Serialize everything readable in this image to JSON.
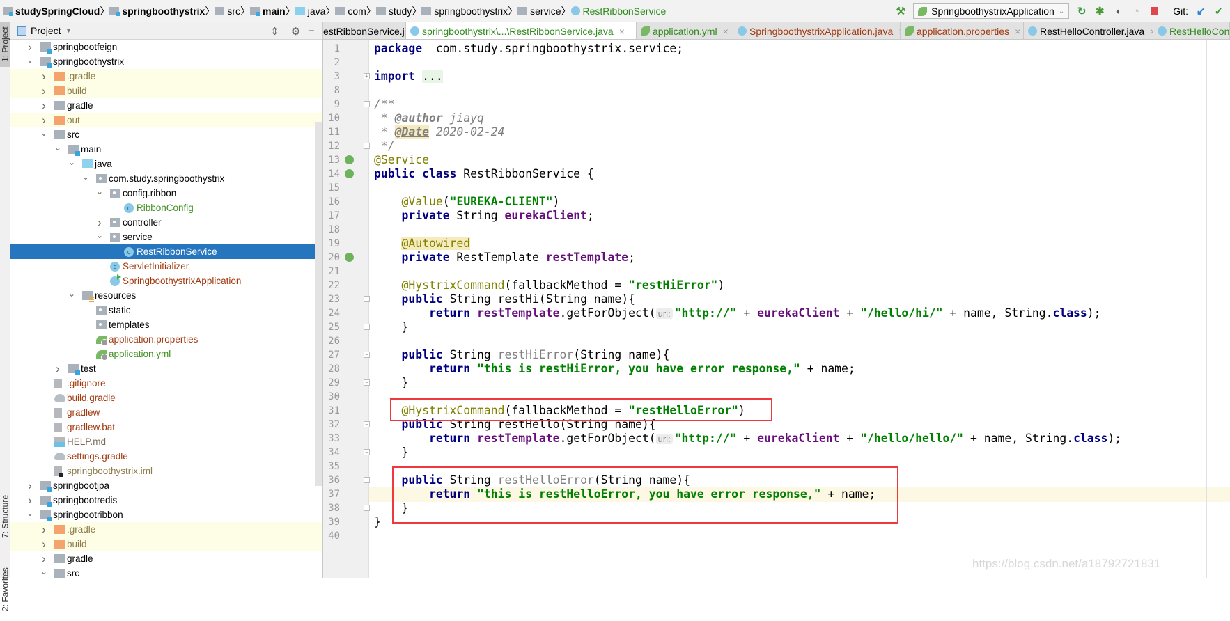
{
  "breadcrumbs": [
    {
      "label": "studySpringCloud",
      "icon": "module-icon",
      "style": "bold"
    },
    {
      "label": "springboothystrix",
      "icon": "module-icon",
      "style": "bold"
    },
    {
      "label": "src",
      "icon": "folder-icon"
    },
    {
      "label": "main",
      "icon": "module-icon",
      "style": "bold"
    },
    {
      "label": "java",
      "icon": "source-folder-icon"
    },
    {
      "label": "com",
      "icon": "package-icon"
    },
    {
      "label": "study",
      "icon": "package-icon"
    },
    {
      "label": "springboothystrix",
      "icon": "package-icon"
    },
    {
      "label": "service",
      "icon": "package-icon"
    },
    {
      "label": "RestRibbonService",
      "icon": "class-icon",
      "style": "green"
    }
  ],
  "toolbar": {
    "run_config": "SpringboothystrixApplication",
    "git_label": "Git:"
  },
  "tool_stripe": {
    "project": "1: Project",
    "structure": "7: Structure",
    "favorites": "2: Favorites"
  },
  "sidebar": {
    "title": "Project",
    "tree": [
      {
        "label": "springbootfeign",
        "level": 0,
        "exp": "closed",
        "icon": "f-mod",
        "color": "#000"
      },
      {
        "label": "springboothystrix",
        "level": 0,
        "exp": "open",
        "icon": "f-mod",
        "color": "#000"
      },
      {
        "label": ".gradle",
        "level": 1,
        "exp": "closed",
        "icon": "f-orange",
        "color": "#8c7d4a",
        "hl": true
      },
      {
        "label": "build",
        "level": 1,
        "exp": "closed",
        "icon": "f-orange",
        "color": "#8c7d4a",
        "hl": true
      },
      {
        "label": "gradle",
        "level": 1,
        "exp": "closed",
        "icon": "f-gray",
        "color": "#000"
      },
      {
        "label": "out",
        "level": 1,
        "exp": "closed",
        "icon": "f-orange",
        "color": "#8c7d4a",
        "hl": true
      },
      {
        "label": "src",
        "level": 1,
        "exp": "open",
        "icon": "f-gray",
        "color": "#000"
      },
      {
        "label": "main",
        "level": 2,
        "exp": "open",
        "icon": "f-src",
        "color": "#000"
      },
      {
        "label": "java",
        "level": 3,
        "exp": "open",
        "icon": "f-blue",
        "color": "#000"
      },
      {
        "label": "com.study.springboothystrix",
        "level": 4,
        "exp": "open",
        "icon": "f-pkg",
        "color": "#000"
      },
      {
        "label": "config.ribbon",
        "level": 5,
        "exp": "open",
        "icon": "f-pkg",
        "color": "#000"
      },
      {
        "label": "RibbonConfig",
        "level": 6,
        "icon": "c-cls",
        "color": "#3f8f20"
      },
      {
        "label": "controller",
        "level": 5,
        "exp": "closed",
        "icon": "f-pkg",
        "color": "#000"
      },
      {
        "label": "service",
        "level": 5,
        "exp": "open",
        "icon": "f-pkg",
        "color": "#000"
      },
      {
        "label": "RestRibbonService",
        "level": 6,
        "icon": "c-cls",
        "color": "#fff",
        "sel": true
      },
      {
        "label": "ServletInitializer",
        "level": 5,
        "icon": "c-cls",
        "color": "#a3390f"
      },
      {
        "label": "SpringboothystrixApplication",
        "level": 5,
        "icon": "c-spring",
        "color": "#a3390f"
      },
      {
        "label": "resources",
        "level": 3,
        "exp": "open",
        "icon": "f-res",
        "color": "#000"
      },
      {
        "label": "static",
        "level": 4,
        "icon": "f-pkg",
        "color": "#000"
      },
      {
        "label": "templates",
        "level": 4,
        "icon": "f-pkg",
        "color": "#000"
      },
      {
        "label": "application.properties",
        "level": 4,
        "icon": "s-leaf",
        "color": "#a3390f"
      },
      {
        "label": "application.yml",
        "level": 4,
        "icon": "s-leaf",
        "color": "#3f8f20"
      },
      {
        "label": "test",
        "level": 2,
        "exp": "closed",
        "icon": "f-src",
        "color": "#000"
      },
      {
        "label": ".gitignore",
        "level": 1,
        "icon": "file-txt",
        "color": "#a3390f"
      },
      {
        "label": "build.gradle",
        "level": 1,
        "icon": "gradle",
        "color": "#a3390f"
      },
      {
        "label": "gradlew",
        "level": 1,
        "icon": "file-txt",
        "color": "#a3390f"
      },
      {
        "label": "gradlew.bat",
        "level": 1,
        "icon": "file-txt",
        "color": "#a3390f"
      },
      {
        "label": "HELP.md",
        "level": 1,
        "icon": "md",
        "color": "#7a6a5a"
      },
      {
        "label": "settings.gradle",
        "level": 1,
        "icon": "gradle",
        "color": "#a3390f"
      },
      {
        "label": "springboothystrix.iml",
        "level": 1,
        "icon": "iml",
        "color": "#8c7d4a"
      },
      {
        "label": "springbootjpa",
        "level": 0,
        "exp": "closed",
        "icon": "f-mod",
        "color": "#000"
      },
      {
        "label": "springbootredis",
        "level": 0,
        "exp": "closed",
        "icon": "f-mod",
        "color": "#000"
      },
      {
        "label": "springbootribbon",
        "level": 0,
        "exp": "open",
        "icon": "f-mod",
        "color": "#000"
      },
      {
        "label": ".gradle",
        "level": 1,
        "exp": "closed",
        "icon": "f-orange",
        "color": "#8c7d4a",
        "hl": true
      },
      {
        "label": "build",
        "level": 1,
        "exp": "closed",
        "icon": "f-orange",
        "color": "#8c7d4a",
        "hl": true
      },
      {
        "label": "gradle",
        "level": 1,
        "exp": "closed",
        "icon": "f-gray",
        "color": "#000"
      },
      {
        "label": "src",
        "level": 1,
        "exp": "open",
        "icon": "f-gray",
        "color": "#000"
      }
    ]
  },
  "tabs": [
    {
      "label": "estRibbonService.java",
      "color": "#000",
      "icon": "none"
    },
    {
      "label": "springboothystrix\\...\\RestRibbonService.java",
      "color": "#2f8a1c",
      "icon": "class",
      "active": true
    },
    {
      "label": "application.yml",
      "color": "#2f8a1c",
      "icon": "leaf"
    },
    {
      "label": "SpringboothystrixApplication.java",
      "color": "#a3390f",
      "icon": "class"
    },
    {
      "label": "application.properties",
      "color": "#a3390f",
      "icon": "leaf"
    },
    {
      "label": "RestHelloController.java",
      "color": "#000",
      "icon": "class"
    },
    {
      "label": "RestHelloContro",
      "color": "#2f8a1c",
      "icon": "class"
    }
  ],
  "editor": {
    "current_line": 37,
    "lines": [
      {
        "n": 1,
        "t": [
          [
            "kw",
            "package"
          ],
          [
            "",
            "  com.study.springboothystrix.service;"
          ]
        ]
      },
      {
        "n": 2,
        "t": []
      },
      {
        "n": 3,
        "fold": "+",
        "t": [
          [
            "kw",
            "import"
          ],
          [
            "",
            " "
          ],
          [
            "foldt",
            "..."
          ]
        ]
      },
      {
        "n": 8,
        "t": []
      },
      {
        "n": 9,
        "fold": "-",
        "t": [
          [
            "cmt",
            "/**"
          ]
        ]
      },
      {
        "n": 10,
        "t": [
          [
            "cmt",
            " * "
          ],
          [
            "tag",
            "@author"
          ],
          [
            "cmt",
            " jiayq"
          ]
        ]
      },
      {
        "n": 11,
        "t": [
          [
            "cmt",
            " * "
          ],
          [
            "tagh",
            "@Date"
          ],
          [
            "cmt",
            " 2020-02-24"
          ]
        ]
      },
      {
        "n": 12,
        "fold": "-",
        "t": [
          [
            "cmt",
            " */"
          ]
        ]
      },
      {
        "n": 13,
        "gicon": "spring-bean-icon",
        "t": [
          [
            "ann",
            "@Service"
          ]
        ]
      },
      {
        "n": 14,
        "gicon": "spring-class-icon",
        "t": [
          [
            "kw",
            "public class"
          ],
          [
            "",
            " RestRibbonService {"
          ]
        ]
      },
      {
        "n": 15,
        "t": []
      },
      {
        "n": 16,
        "t": [
          [
            "",
            "    "
          ],
          [
            "ann",
            "@Value"
          ],
          [
            "",
            "("
          ],
          [
            "str",
            "\"EUREKA-CLIENT\""
          ],
          [
            "",
            ")"
          ]
        ]
      },
      {
        "n": 17,
        "t": [
          [
            "",
            "    "
          ],
          [
            "kw",
            "private"
          ],
          [
            "",
            " String "
          ],
          [
            "fld",
            "eurekaClient"
          ],
          [
            "",
            ";"
          ]
        ]
      },
      {
        "n": 18,
        "t": []
      },
      {
        "n": 19,
        "t": [
          [
            "",
            "    "
          ],
          [
            "annh",
            "@Autowired"
          ]
        ]
      },
      {
        "n": 20,
        "gicon": "autowired-icon",
        "t": [
          [
            "",
            "    "
          ],
          [
            "kw",
            "private"
          ],
          [
            "",
            " RestTemplate "
          ],
          [
            "fld",
            "restTemplate"
          ],
          [
            "",
            ";"
          ]
        ]
      },
      {
        "n": 21,
        "t": []
      },
      {
        "n": 22,
        "t": [
          [
            "",
            "    "
          ],
          [
            "ann",
            "@HystrixCommand"
          ],
          [
            "",
            "(fallbackMethod = "
          ],
          [
            "str",
            "\"restHiError\""
          ],
          [
            "",
            ")"
          ]
        ]
      },
      {
        "n": 23,
        "fold": "-",
        "t": [
          [
            "",
            "    "
          ],
          [
            "kw",
            "public"
          ],
          [
            "",
            " String restHi(String name){"
          ]
        ]
      },
      {
        "n": 24,
        "t": [
          [
            "",
            "        "
          ],
          [
            "kw",
            "return"
          ],
          [
            "",
            " "
          ],
          [
            "fld",
            "restTemplate"
          ],
          [
            "",
            ".getForObject("
          ],
          [
            "hint",
            "url:"
          ],
          [
            "str",
            "\"http://\""
          ],
          [
            "",
            " + "
          ],
          [
            "fld",
            "eurekaClient"
          ],
          [
            "",
            " + "
          ],
          [
            "str",
            "\"/hello/hi/\""
          ],
          [
            "",
            " + name, String."
          ],
          [
            "kw",
            "class"
          ],
          [
            "",
            ");"
          ]
        ]
      },
      {
        "n": 25,
        "fold": "-",
        "t": [
          [
            "",
            "    }"
          ]
        ]
      },
      {
        "n": 26,
        "t": []
      },
      {
        "n": 27,
        "fold": "-",
        "t": [
          [
            "",
            "    "
          ],
          [
            "kw",
            "public"
          ],
          [
            "",
            " String "
          ],
          [
            "unused",
            "restHiError"
          ],
          [
            "",
            "(String name){"
          ]
        ]
      },
      {
        "n": 28,
        "t": [
          [
            "",
            "        "
          ],
          [
            "kw",
            "return"
          ],
          [
            "",
            " "
          ],
          [
            "str",
            "\"this is restHiError, you have error response,\""
          ],
          [
            "",
            " + name;"
          ]
        ]
      },
      {
        "n": 29,
        "fold": "-",
        "t": [
          [
            "",
            "    }"
          ]
        ]
      },
      {
        "n": 30,
        "t": []
      },
      {
        "n": 31,
        "t": [
          [
            "",
            "    "
          ],
          [
            "ann",
            "@HystrixCommand"
          ],
          [
            "",
            "(fallbackMethod = "
          ],
          [
            "str",
            "\"restHelloError\""
          ],
          [
            "",
            ")"
          ]
        ]
      },
      {
        "n": 32,
        "fold": "-",
        "t": [
          [
            "",
            "    "
          ],
          [
            "kw",
            "public"
          ],
          [
            "",
            " String restHello(String name){"
          ]
        ]
      },
      {
        "n": 33,
        "t": [
          [
            "",
            "        "
          ],
          [
            "kw",
            "return"
          ],
          [
            "",
            " "
          ],
          [
            "fld",
            "restTemplate"
          ],
          [
            "",
            ".getForObject("
          ],
          [
            "hint",
            "url:"
          ],
          [
            "str",
            "\"http://\""
          ],
          [
            "",
            " + "
          ],
          [
            "fld",
            "eurekaClient"
          ],
          [
            "",
            " + "
          ],
          [
            "str",
            "\"/hello/hello/\""
          ],
          [
            "",
            " + name, String."
          ],
          [
            "kw",
            "class"
          ],
          [
            "",
            ");"
          ]
        ]
      },
      {
        "n": 34,
        "fold": "-",
        "t": [
          [
            "",
            "    }"
          ]
        ]
      },
      {
        "n": 35,
        "t": []
      },
      {
        "n": 36,
        "fold": "-",
        "t": [
          [
            "",
            "    "
          ],
          [
            "kw",
            "public"
          ],
          [
            "",
            " String "
          ],
          [
            "unused",
            "restHelloError"
          ],
          [
            "",
            "(String name){"
          ]
        ]
      },
      {
        "n": 37,
        "t": [
          [
            "",
            "        "
          ],
          [
            "kw",
            "return"
          ],
          [
            "",
            " "
          ],
          [
            "str",
            "\"this is restHelloError, you have error response,\""
          ],
          [
            "",
            " + name;"
          ]
        ]
      },
      {
        "n": 38,
        "fold": "-",
        "t": [
          [
            "",
            "    }"
          ]
        ]
      },
      {
        "n": 39,
        "t": [
          [
            "",
            "}"
          ]
        ]
      },
      {
        "n": 40,
        "t": []
      }
    ]
  },
  "annotation_color": "#f0393e",
  "watermark": "https://blog.csdn.net/a18792721831"
}
